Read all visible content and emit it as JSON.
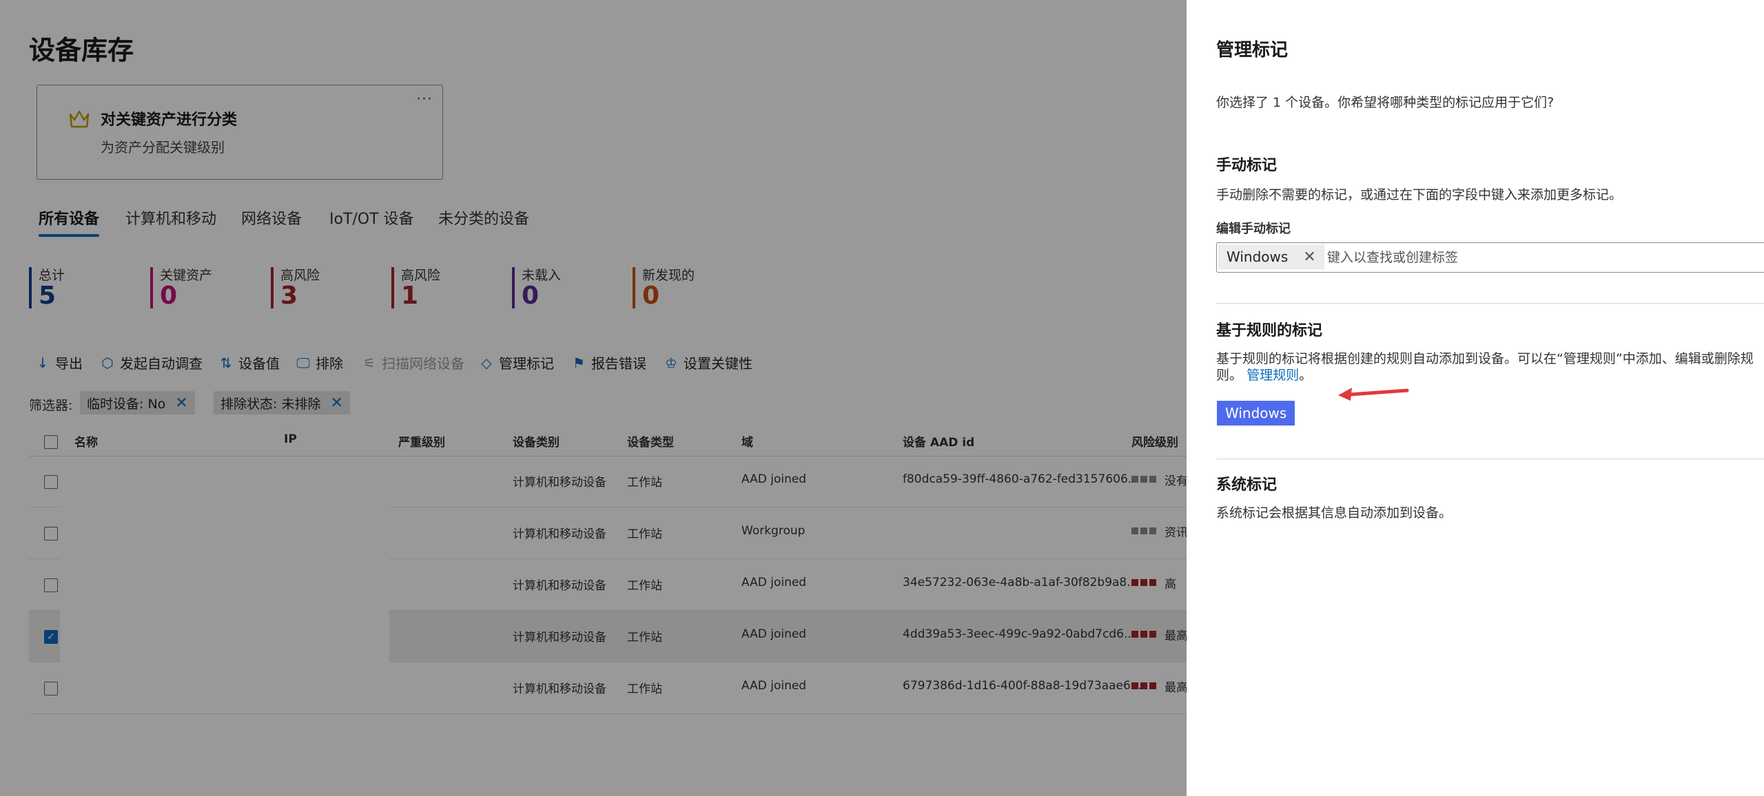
{
  "page": {
    "title": "设备库存"
  },
  "card": {
    "title": "对关键资产进行分类",
    "subtitle": "为资产分配关键级别",
    "more": "···"
  },
  "tabs": [
    "所有设备",
    "计算机和移动",
    "网络设备",
    "IoT/OT 设备",
    "未分类的设备"
  ],
  "stats": [
    {
      "label": "总计",
      "value": "5",
      "color": "#0f3f8c"
    },
    {
      "label": "关键资产",
      "value": "0",
      "color": "#c4147a"
    },
    {
      "label": "高风险",
      "value": "3",
      "color": "#a4262c"
    },
    {
      "label": "高风险",
      "value": "1",
      "color": "#a4262c"
    },
    {
      "label": "未载入",
      "value": "0",
      "color": "#5c2e91"
    },
    {
      "label": "新发现的",
      "value": "0",
      "color": "#ca5010"
    }
  ],
  "toolbar": [
    {
      "icon": "download-icon",
      "glyph": "↓",
      "label": "导出"
    },
    {
      "icon": "hexagon-icon",
      "glyph": "⬡",
      "label": "发起自动调查"
    },
    {
      "icon": "sort-icon",
      "glyph": "⇅",
      "label": "设备值"
    },
    {
      "icon": "monitor-icon",
      "glyph": "🖵",
      "label": "排除"
    },
    {
      "icon": "scan-icon",
      "glyph": "⚟",
      "label": "扫描网络设备",
      "disabled": true
    },
    {
      "icon": "tag-icon",
      "glyph": "◇",
      "label": "管理标记"
    },
    {
      "icon": "report-icon",
      "glyph": "⚑",
      "label": "报告错误"
    },
    {
      "icon": "crown-icon",
      "glyph": "♔",
      "label": "设置关键性"
    }
  ],
  "filters": {
    "label": "筛选器:",
    "chips": [
      "临时设备: No",
      "排除状态: 未排除"
    ]
  },
  "table": {
    "headers": [
      "名称",
      "IP",
      "严重级别",
      "设备类别",
      "设备类型",
      "域",
      "设备 AAD id",
      "风险级别"
    ],
    "rows": [
      {
        "category": "计算机和移动设备",
        "type": "工作站",
        "domain": "AAD joined",
        "aad": "f80dca59-39ff-4860-a762-fed3157606...",
        "risk": "没有",
        "riskColor": "#8a8a8a",
        "checked": false
      },
      {
        "category": "计算机和移动设备",
        "type": "工作站",
        "domain": "Workgroup",
        "aad": "",
        "risk": "资讯",
        "riskColor": "#8a8a8a",
        "checked": false
      },
      {
        "category": "计算机和移动设备",
        "type": "工作站",
        "domain": "AAD joined",
        "aad": "34e57232-063e-4a8b-a1af-30f82b9a8...",
        "risk": "高",
        "riskColor": "#a4262c",
        "checked": false
      },
      {
        "category": "计算机和移动设备",
        "type": "工作站",
        "domain": "AAD joined",
        "aad": "4dd39a53-3eec-499c-9a92-0abd7cd6...",
        "risk": "最高",
        "riskColor": "#a4262c",
        "checked": true
      },
      {
        "category": "计算机和移动设备",
        "type": "工作站",
        "domain": "AAD joined",
        "aad": "6797386d-1d16-400f-88a8-19d73aae6...",
        "risk": "最高",
        "riskColor": "#a4262c",
        "checked": false
      }
    ]
  },
  "panel": {
    "title": "管理标记",
    "intro": "你选择了 1 个设备。你希望将哪种类型的标记应用于它们?",
    "manual": {
      "heading": "手动标记",
      "desc": "手动删除不需要的标记，或通过在下面的字段中键入来添加更多标记。",
      "edit_label": "编辑手动标记",
      "tag": "Windows",
      "placeholder": "键入以查找或创建标签"
    },
    "rule": {
      "heading": "基于规则的标记",
      "desc1": "基于规则的标记将根据创建的规则自动添加到设备。可以在“管理规则”中添加、编辑或删除规",
      "desc2_prefix": "则。",
      "link": "管理规则",
      "desc2_suffix": "。",
      "tag": "Windows"
    },
    "system": {
      "heading": "系统标记",
      "desc": "系统标记会根据其信息自动添加到设备。"
    }
  }
}
